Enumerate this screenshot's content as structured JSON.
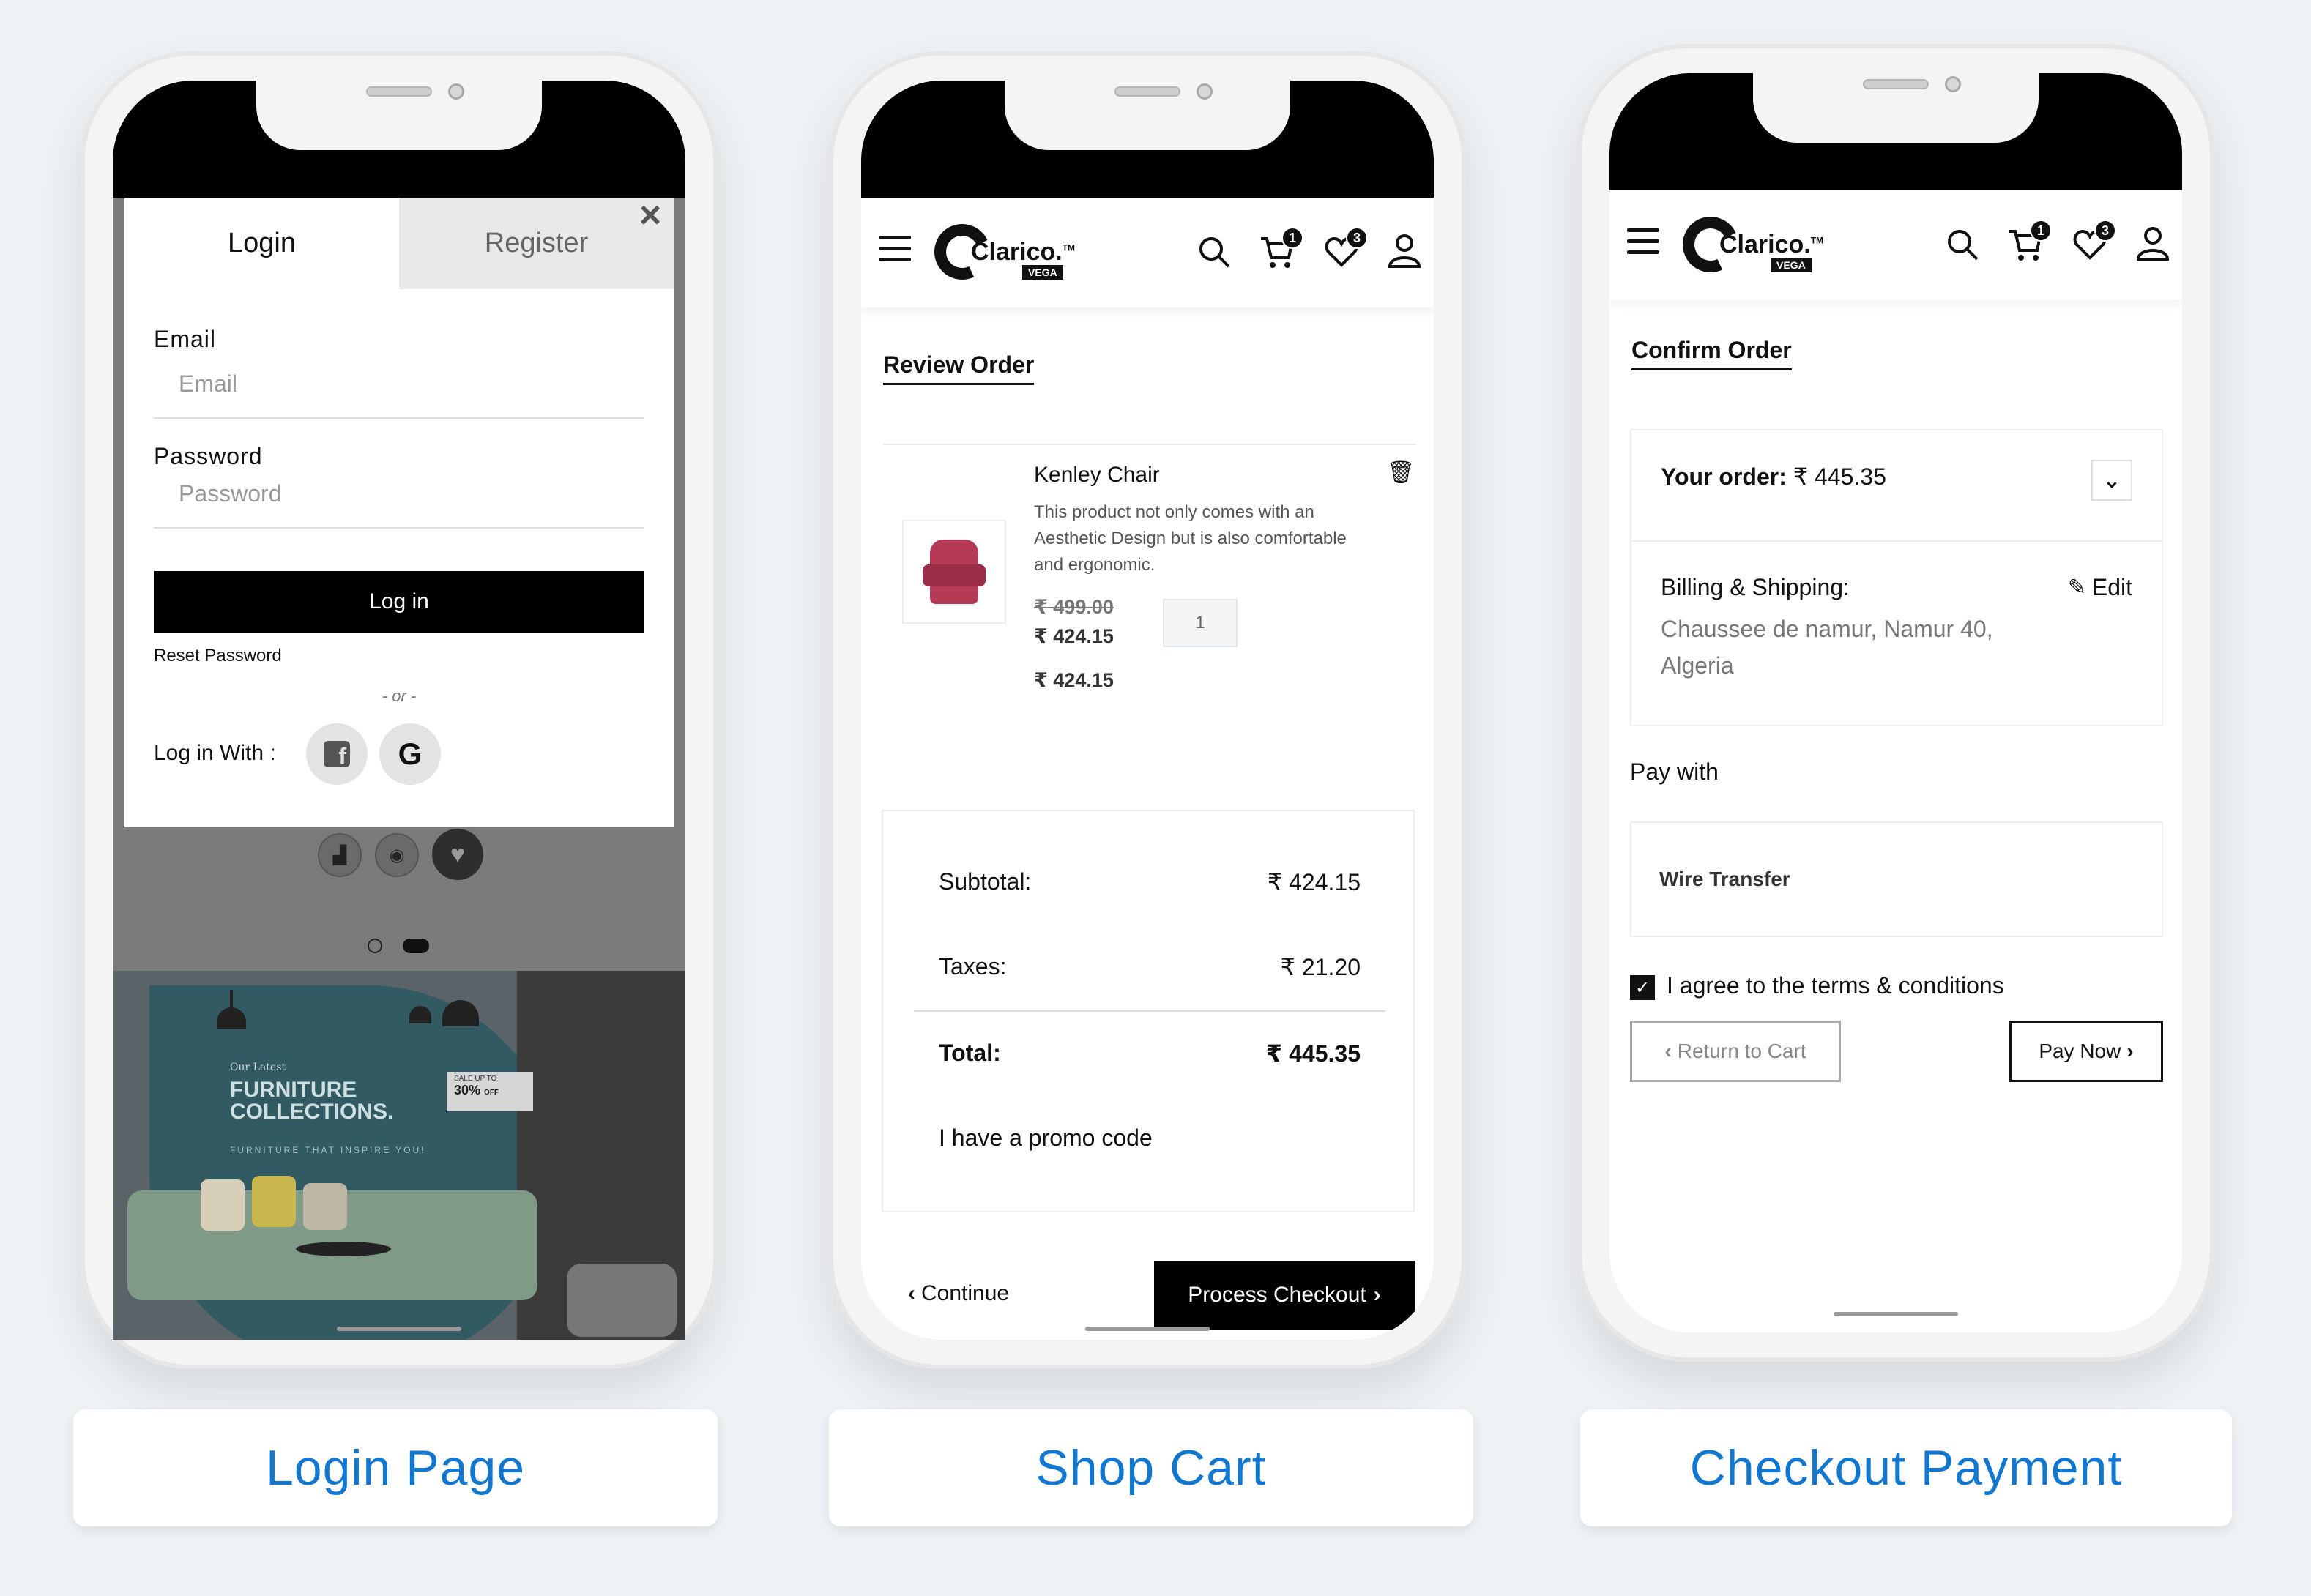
{
  "captions": {
    "login": "Login Page",
    "cart": "Shop Cart",
    "checkout": "Checkout Payment"
  },
  "brand": {
    "name": "Clarico.",
    "tm": "TM",
    "badge": "VEGA",
    "accent": "#1177d1"
  },
  "header_badges": {
    "cart": "1",
    "wishlist": "3"
  },
  "login": {
    "tabs": [
      "Login",
      "Register"
    ],
    "close": "×",
    "email_label": "Email",
    "email_placeholder": "Email",
    "password_label": "Password",
    "password_placeholder": "Password",
    "login_button": "Log in",
    "reset_link": "Reset Password",
    "or_text": "- or -",
    "login_with": "Log in With :",
    "banner": {
      "small": "Our Latest",
      "title_line1": "FURNITURE",
      "title_line2": "COLLECTIONS.",
      "tagline": "FURNITURE THAT INSPIRE YOU!",
      "sale_top": "SALE UP TO",
      "sale_value": "30%",
      "sale_off": "OFF"
    }
  },
  "cart": {
    "title": "Review Order",
    "item": {
      "name": "Kenley Chair",
      "description": "This product not only comes with an Aesthetic Design but is also comfortable and ergonomic.",
      "old_price": "₹ 499.00",
      "price": "₹ 424.15",
      "line_total": "₹ 424.15",
      "quantity": "1"
    },
    "subtotal_label": "Subtotal:",
    "subtotal_value": "₹ 424.15",
    "taxes_label": "Taxes:",
    "taxes_value": "₹ 21.20",
    "total_label": "Total:",
    "total_value": "₹ 445.35",
    "promo_link": "I have a promo code",
    "continue_label": "Continue",
    "checkout_label": "Process Checkout"
  },
  "checkout": {
    "title": "Confirm Order",
    "order_label": "Your order:",
    "order_value": "₹ 445.35",
    "billing_label": "Billing & Shipping:",
    "edit_label": "Edit",
    "address": "Chaussee de namur, Namur 40, Algeria",
    "pay_with": "Pay with",
    "method": "Wire Transfer",
    "terms": "I agree to the terms & conditions",
    "return_label": "Return to Cart",
    "pay_label": "Pay Now"
  }
}
